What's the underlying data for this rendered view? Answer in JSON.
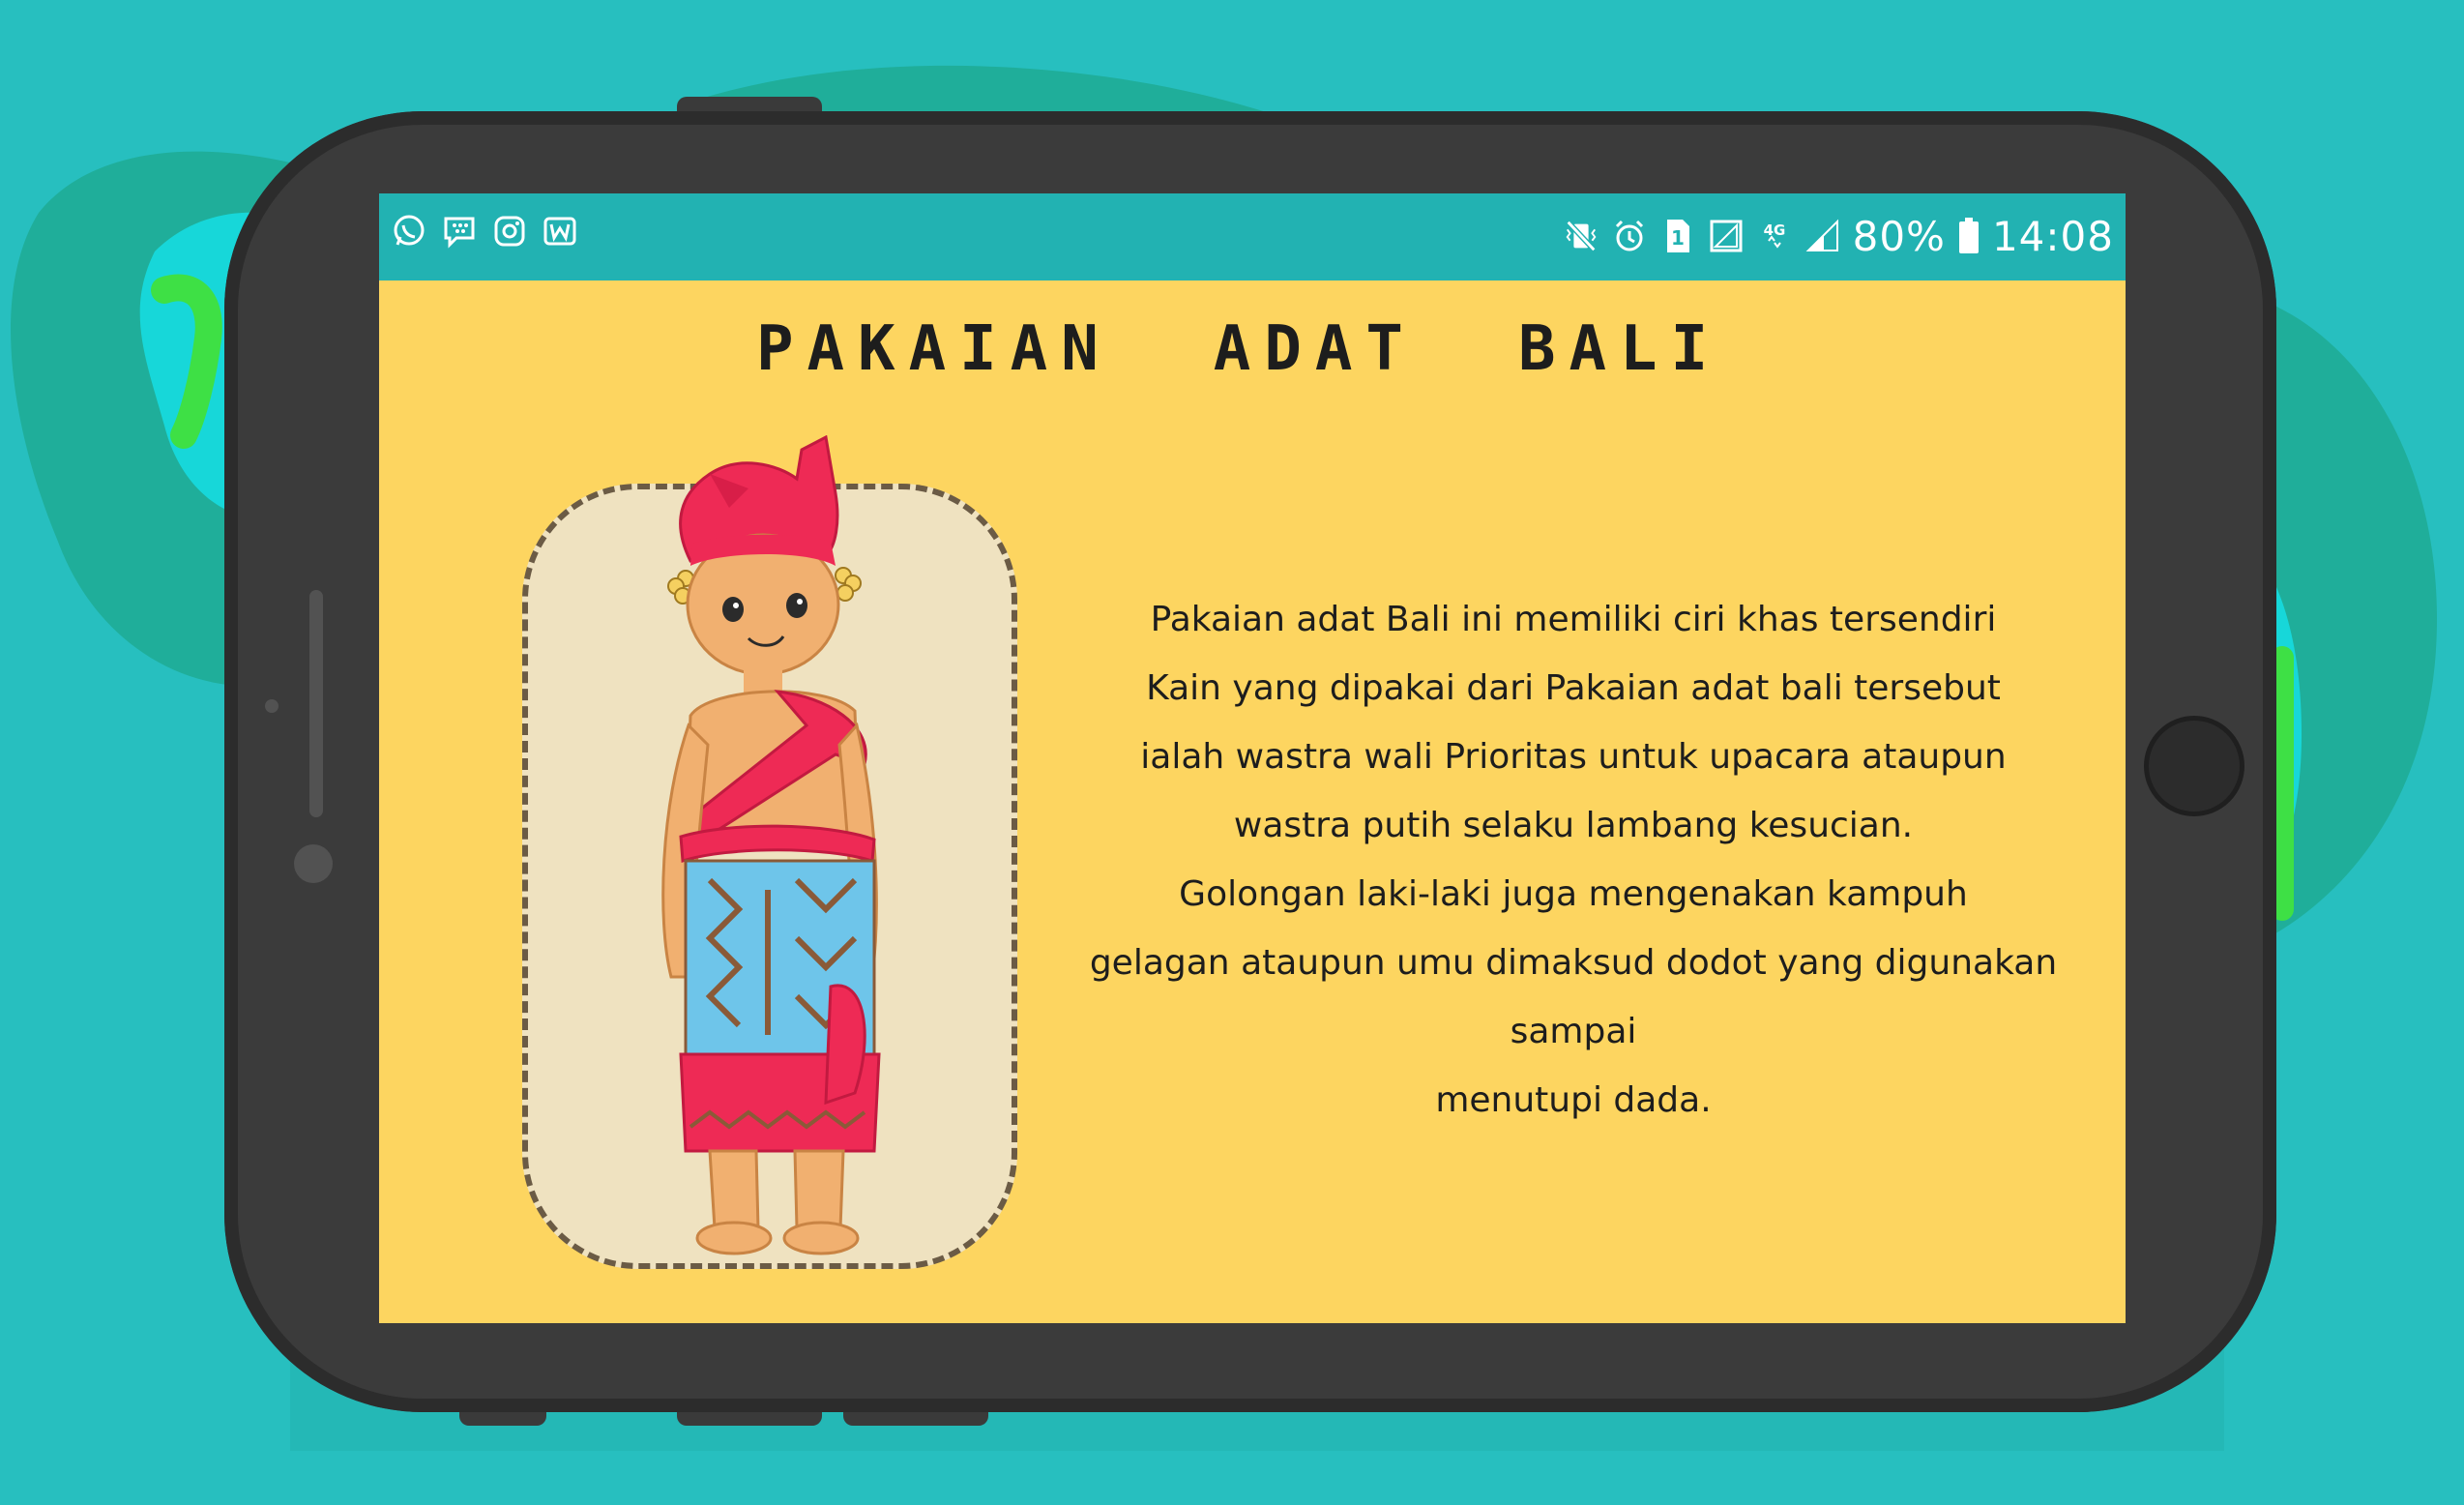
{
  "statusbar": {
    "left_icons": [
      "whatsapp-icon",
      "bbm-icon",
      "instagram-icon",
      "wattpad-icon"
    ],
    "right_icons": [
      "vibrate-icon",
      "alarm-icon",
      "sim-icon",
      "signal-icon",
      "network-4g-icon",
      "signal-bars-icon",
      "battery-icon"
    ],
    "battery": "80%",
    "time": "14:08"
  },
  "page": {
    "title": "PAKAIAN  ADAT  BALI",
    "description_lines": [
      "Pakaian adat Bali ini memiliki ciri khas tersendiri",
      "Kain yang dipakai dari Pakaian adat bali tersebut",
      "ialah wastra wali Prioritas untuk upacara ataupun",
      "wastra putih selaku lambang kesucian.",
      "Golongan laki-laki juga mengenakan kampuh",
      "gelagan ataupun umu dimaksud dodot yang digunakan sampai",
      "menutupi dada."
    ]
  },
  "colors": {
    "background": "#27bfbf",
    "statusbar": "#22b2b2",
    "screen": "#fdd560",
    "card": "#efe2c0",
    "headdress": "#ee2a55",
    "sarong": "#6ec5ea",
    "skin": "#f1b070"
  }
}
